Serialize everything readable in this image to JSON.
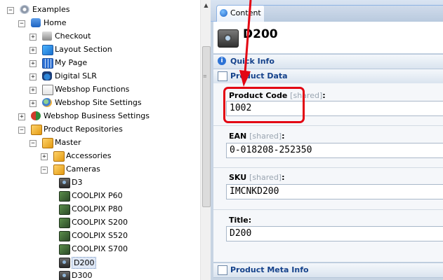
{
  "tree": {
    "items": [
      {
        "label": "Examples",
        "expander": "−",
        "icon": "gear-icon"
      },
      {
        "label": "Home",
        "expander": "−",
        "icon": "home-icon"
      },
      {
        "label": "Checkout",
        "expander": "+",
        "icon": "cart-icon"
      },
      {
        "label": "Layout Section",
        "expander": "+",
        "icon": "layout-icon"
      },
      {
        "label": "My Page",
        "expander": "+",
        "icon": "grid-icon"
      },
      {
        "label": "Digital SLR",
        "expander": "+",
        "icon": "camera-lens-icon"
      },
      {
        "label": "Webshop Functions",
        "expander": "+",
        "icon": "page-icon"
      },
      {
        "label": "Webshop Site Settings",
        "expander": "+",
        "icon": "globe-settings-icon"
      },
      {
        "label": "Webshop Business Settings",
        "expander": "+",
        "icon": "business-icon"
      },
      {
        "label": "Product Repositories",
        "expander": "−",
        "icon": "cube-icon"
      },
      {
        "label": "Master",
        "expander": "−",
        "icon": "cube-icon"
      },
      {
        "label": "Accessories",
        "expander": "+",
        "icon": "cube-icon"
      },
      {
        "label": "Cameras",
        "expander": "−",
        "icon": "cube-icon"
      },
      {
        "label": "D3",
        "expander": "",
        "icon": "camera-icon"
      },
      {
        "label": "COOLPIX P60",
        "expander": "",
        "icon": "compact-camera-icon"
      },
      {
        "label": "COOLPIX P80",
        "expander": "",
        "icon": "compact-camera-icon"
      },
      {
        "label": "COOLPIX S200",
        "expander": "",
        "icon": "compact-camera-icon"
      },
      {
        "label": "COOLPIX S520",
        "expander": "",
        "icon": "compact-camera-icon"
      },
      {
        "label": "COOLPIX S700",
        "expander": "",
        "icon": "compact-camera-icon"
      },
      {
        "label": "D200",
        "expander": "",
        "icon": "camera-icon",
        "selected": true
      },
      {
        "label": "D300",
        "expander": "",
        "icon": "camera-icon"
      }
    ]
  },
  "scrollbar": {
    "up_arrow": "▲",
    "grip": "≡"
  },
  "tabs": {
    "content_label": "Content"
  },
  "item": {
    "title": "D200"
  },
  "sections": {
    "quick_info": "Quick Info",
    "product_data": "Product Data",
    "product_meta_info": "Product Meta Info"
  },
  "fields": {
    "shared_tag": "[shared]",
    "product_code": {
      "label": "Product Code",
      "value": "1002"
    },
    "ean": {
      "label": "EAN",
      "value": "0-018208-252350"
    },
    "sku": {
      "label": "SKU",
      "value": "IMCNKD200"
    },
    "title": {
      "label": "Title:",
      "value": "D200"
    }
  },
  "colors": {
    "highlight": "#e30613",
    "accent": "#15428b"
  }
}
